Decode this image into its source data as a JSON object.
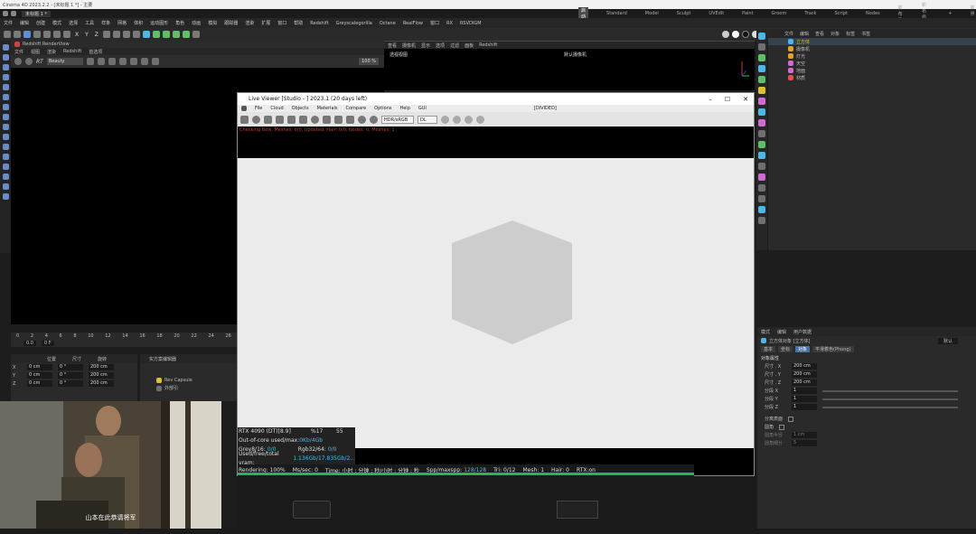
{
  "window": {
    "title": "Cinema 4D 2023.2.2 - [未标题 1 *] - 主要"
  },
  "tabs": [
    {
      "label": "未标题 1 *"
    }
  ],
  "menu": [
    "文件",
    "编辑",
    "创建",
    "模式",
    "选择",
    "工具",
    "样条",
    "网格",
    "体积",
    "运动图形",
    "角色",
    "动画",
    "模拟",
    "跟踪器",
    "渲染",
    "扩展",
    "窗口",
    "帮助",
    "Redshift",
    "Greyscalegorilla",
    "Octane",
    "RealFlow",
    "窗口",
    "RX",
    "RSVDIGM"
  ],
  "layouts": [
    "启动",
    "Standard",
    "Model",
    "Sculpt",
    "UVEdit",
    "Paint",
    "Groom",
    "Track",
    "Script",
    "Nodes",
    "新布局",
    "新布局(2)",
    "+",
    "新界面"
  ],
  "toolbar_axes": [
    "X",
    "Y",
    "Z"
  ],
  "rv_panel": {
    "title": "Redshift RenderView",
    "menu": [
      "文件",
      "视图",
      "渲染",
      "Redshift",
      "首选项"
    ],
    "dropdown": "Beauty",
    "zoom": "100 %"
  },
  "viewport": {
    "menu": [
      "查看",
      "摄像机",
      "显示",
      "选项",
      "过滤",
      "面板",
      "Redshift"
    ],
    "label_left": "透视视图",
    "label_right": "默认摄像机"
  },
  "live_viewer": {
    "title": "Live Viewer [Studio - ] 2023.1 (20 days left)",
    "menu": [
      "File",
      "Cloud",
      "Objects",
      "Materials",
      "Compare",
      "Options",
      "Help",
      "GUI"
    ],
    "status_center": "[DIVIDED]",
    "status_line": "Checking Bow, Meshes: 0/0, Updated, Hair: 0/0, Nodes: 0, Meshes: 1",
    "dropdown": "HDR/sRGB",
    "dropdown2": "DL",
    "stats": {
      "gpu": "RTX 4090 (DT)[8.9]",
      "gpu_pct": "%17",
      "gpu_temp": "55",
      "out_of_core_label": "Out-of-core used/max:",
      "out_of_core_value": "0Kb/4Gb",
      "grey_label": "Grey8/16:",
      "grey_value": "0/0",
      "rgb_label": "Rgb32/64:",
      "rgb_value": "0/0",
      "vram_label": "Used/free/total vram:",
      "vram_value": "1.136Gb/17.835Gb/2..."
    },
    "render_line": {
      "rendering": "Rendering: 100%",
      "mssec": "Ms/sec: 0",
      "time": "Time: 小时 : 分钟 : 秒/小时 : 分钟 : 秒",
      "spp": "Spp/maxspp:",
      "spp_value": "128/128",
      "tri": "Tri: 0/12",
      "mesh": "Mesh: 1",
      "hair": "Hair: 0",
      "rtx": "RTX:on"
    },
    "progress": 1.0
  },
  "objects": {
    "menu": [
      "文件",
      "编辑",
      "查看",
      "对象",
      "标签",
      "书签"
    ],
    "items": [
      {
        "name": "立方体",
        "color": "#6fb7e8"
      },
      {
        "name": "摄像机",
        "color": "#e0a030"
      },
      {
        "name": "灯光",
        "color": "#e0a030"
      },
      {
        "name": "天空",
        "color": "#d06bd0"
      },
      {
        "name": "地面",
        "color": "#d06bd0"
      },
      {
        "name": "材质",
        "color": "#e05050"
      }
    ]
  },
  "timeline": {
    "ticks": [
      "0",
      "2",
      "4",
      "6",
      "8",
      "10",
      "12",
      "14",
      "16",
      "18",
      "20",
      "22",
      "24",
      "26"
    ],
    "frame": "0 F",
    "current": "0.0"
  },
  "coords": {
    "header": [
      "位置",
      "尺寸",
      "旋转"
    ],
    "rows": [
      {
        "axis": "X",
        "pos": "0 cm",
        "rot": "0 °",
        "size": "200 cm"
      },
      {
        "axis": "Y",
        "pos": "0 cm",
        "rot": "0 °",
        "size": "200 cm"
      },
      {
        "axis": "Z",
        "pos": "0 cm",
        "rot": "0 °",
        "size": "200 cm"
      }
    ]
  },
  "lower_mid": {
    "title": "实方案编辑器",
    "item": "Rev Capsule",
    "item2": "外部引"
  },
  "attributes": {
    "menu": [
      "模式",
      "编辑",
      "用户数据"
    ],
    "object": "立方体对象 [立方体]",
    "tabs": [
      "基本",
      "坐标",
      "对象",
      "平滑着色(Phong)"
    ],
    "section": "对象属性",
    "dropdown": "默认",
    "rows": [
      {
        "label": "尺寸 . X",
        "value": "200 cm"
      },
      {
        "label": "尺寸 . Y",
        "value": "200 cm"
      },
      {
        "label": "尺寸 . Z",
        "value": "200 cm"
      },
      {
        "label": "分段 X",
        "value": "1"
      },
      {
        "label": "分段 Y",
        "value": "1"
      },
      {
        "label": "分段 Z",
        "value": "1"
      }
    ],
    "check1": "分离表面",
    "check2": "圆角",
    "extra1": "圆角半径",
    "extra1_value": "1 cm",
    "extra2": "圆角细分",
    "extra2_value": "5"
  },
  "video": {
    "subtitle": "山本在此恭请将军"
  },
  "colors": {
    "accent": "#4fb7e8",
    "progress": "#2fb157",
    "warning": "#b73a2e",
    "cube": "#cdcdcd"
  }
}
